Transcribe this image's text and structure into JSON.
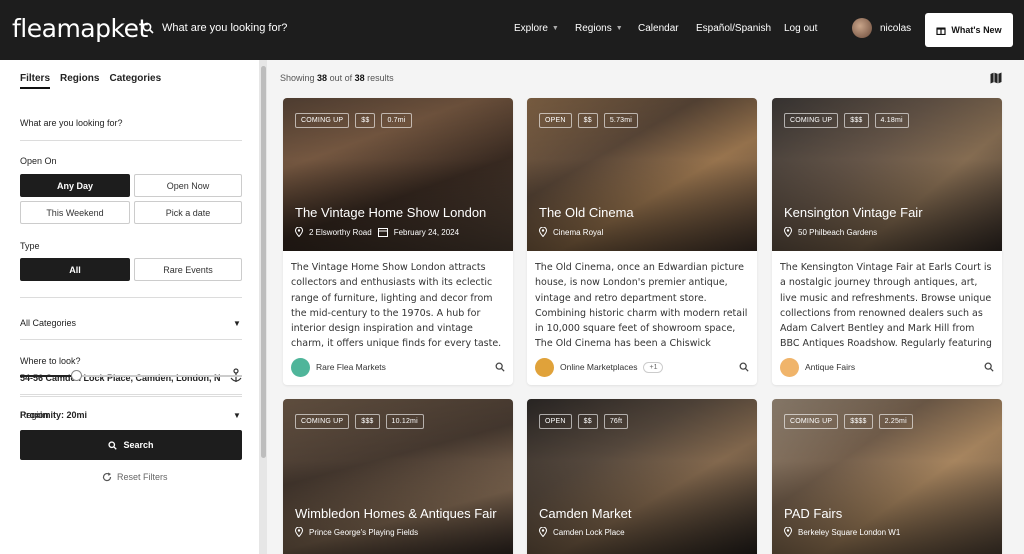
{
  "header": {
    "logo": "fleamapket",
    "search_placeholder": "What are you looking for?",
    "nav": [
      "Explore",
      "Regions",
      "Calendar",
      "Español/Spanish",
      "Log out"
    ],
    "user_name": "nicolas",
    "whats_new": "What's New"
  },
  "sidebar": {
    "tabs": [
      "Filters",
      "Regions",
      "Categories"
    ],
    "search_placeholder": "What are you looking for?",
    "open_on_label": "Open On",
    "open_on_options": [
      "Any Day",
      "Open Now",
      "This Weekend",
      "Pick a date"
    ],
    "type_label": "Type",
    "type_options": [
      "All",
      "Rare Events"
    ],
    "category_select": "All Categories",
    "where_label": "Where to look?",
    "where_value": "54-56 Camden Lock Place, Camden, London, N",
    "proximity_label": "Proximity: 20mi",
    "proximity_fraction": 0.25,
    "region_select": "Region",
    "search_button": "Search",
    "reset_button": "Reset Filters"
  },
  "results": {
    "prefix": "Showing",
    "shown": "38",
    "middle": "out of",
    "total": "38",
    "suffix": "results"
  },
  "cards": [
    {
      "status": "COMING UP",
      "price": "$$",
      "distance": "0.7mi",
      "title": "The Vintage Home Show London",
      "location": "2 Elsworthy Road",
      "date": "February 24, 2024",
      "description": "The Vintage Home Show London attracts collectors and enthusiasts with its eclectic range of furniture, lighting and decor from the mid-century to the 1970s. A hub for interior design inspiration and vintage charm, it offers unique finds for every taste. Engage with",
      "category": "Rare Flea Markets",
      "extra": "",
      "category_color": "#4fb59a"
    },
    {
      "status": "OPEN",
      "price": "$$",
      "distance": "5.73mi",
      "title": "The Old Cinema",
      "location": "Cinema Royal",
      "date": "",
      "description": "The Old Cinema, once an Edwardian picture house, is now London's premier antique, vintage and retro department store. Combining historic charm with modern retail in 10,000 square feet of showroom space, The Old Cinema has been a Chiswick landmark",
      "category": "Online Marketplaces",
      "extra": "+1",
      "category_color": "#e0a23a"
    },
    {
      "status": "COMING UP",
      "price": "$$$",
      "distance": "4.18mi",
      "title": "Kensington Vintage Fair",
      "location": "50 Philbeach Gardens",
      "date": "",
      "description": "The Kensington Vintage Fair at Earls Court is a nostalgic journey through antiques, art, live music and refreshments. Browse unique collections from renowned dealers such as Adam Calvert Bentley and Mark Hill from BBC Antiques Roadshow. Regularly featuring",
      "category": "Antique Fairs",
      "extra": "",
      "category_color": "#f0b46a"
    },
    {
      "status": "COMING UP",
      "price": "$$$",
      "distance": "10.12mi",
      "title": "Wimbledon Homes & Antiques Fair",
      "location": "Prince George's Playing Fields",
      "date": "",
      "description": "",
      "category": "",
      "extra": "",
      "category_color": ""
    },
    {
      "status": "OPEN",
      "price": "$$",
      "distance": "76ft",
      "title": "Camden Market",
      "location": "Camden Lock Place",
      "date": "",
      "description": "",
      "category": "",
      "extra": "",
      "category_color": ""
    },
    {
      "status": "COMING UP",
      "price": "$$$$",
      "distance": "2.25mi",
      "title": "PAD Fairs",
      "location": "Berkeley Square London W1",
      "date": "",
      "description": "",
      "category": "",
      "extra": "",
      "category_color": ""
    }
  ]
}
